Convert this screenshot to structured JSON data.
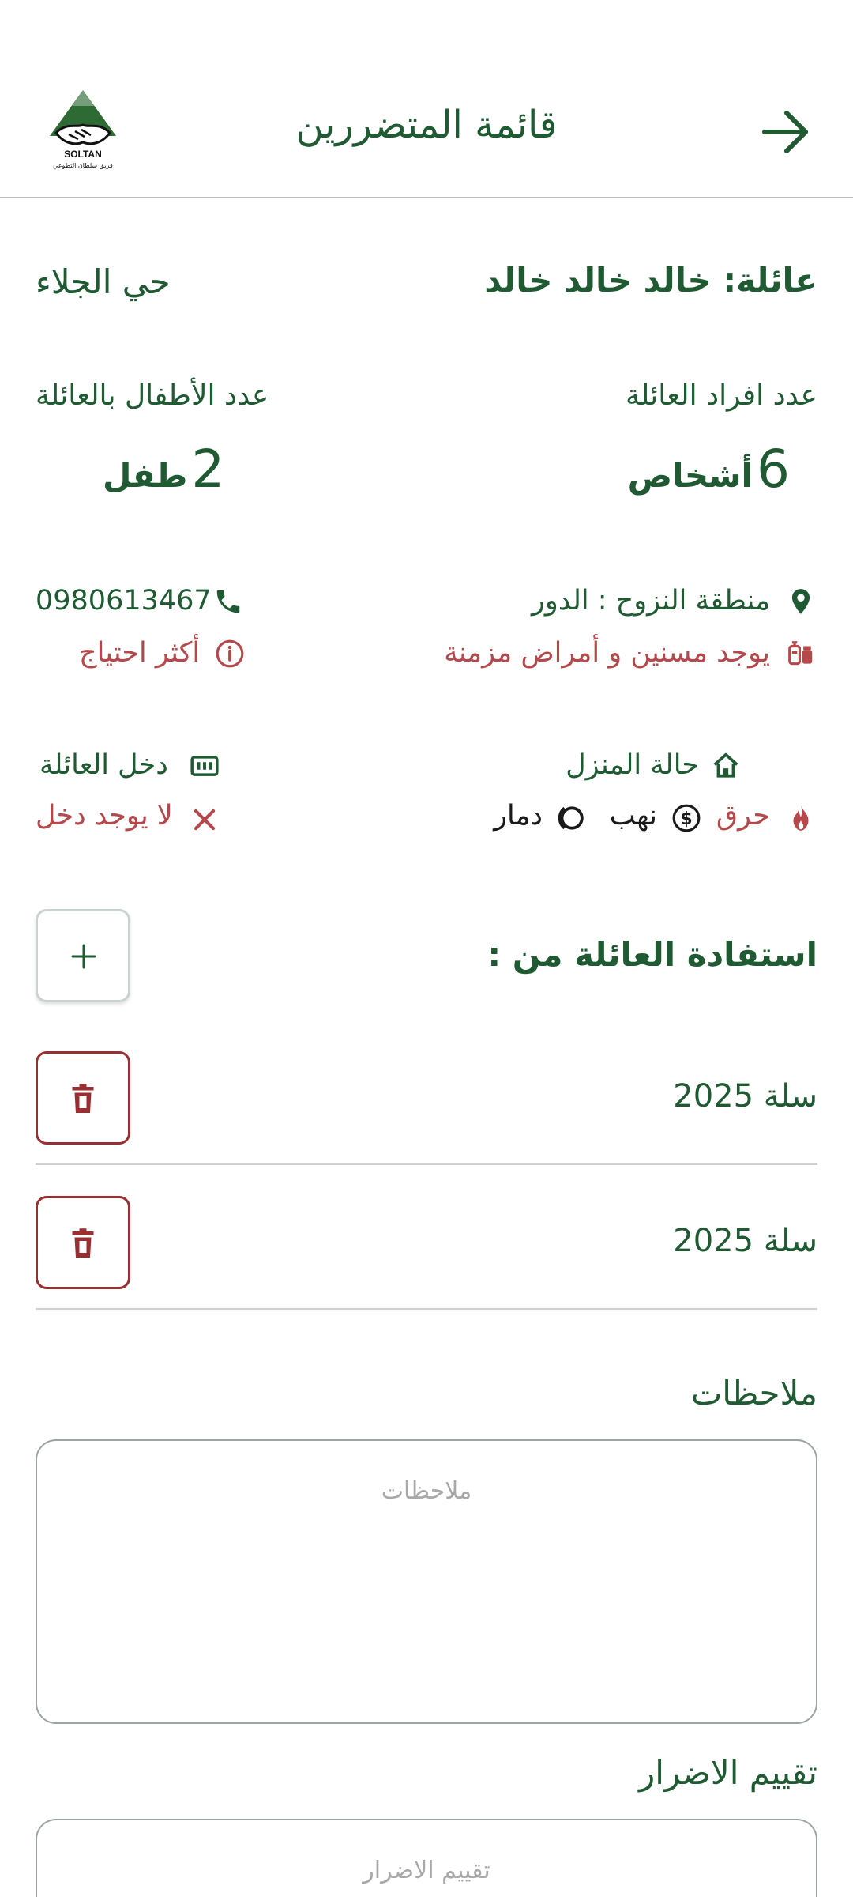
{
  "header": {
    "title": "قائمة المتضررين",
    "logo_text": "SOLTAN TEAM",
    "logo_subtext": "فريق سلطان التطوعي"
  },
  "family": {
    "name": "عائلة: خالد خالد خالد",
    "neighborhood": "حي الجلاء",
    "members_label": "عدد افراد  العائلة",
    "members_count": "6",
    "members_unit": "أشخاص",
    "children_label": "عدد الأطفال بالعائلة",
    "children_count": "2",
    "children_unit": "طفل",
    "displacement_area": "منطقة النزوح : الدور",
    "phone": "0980613467",
    "health_note": "يوجد مسنين و أمراض مزمنة",
    "need_level": "أكثر احتياج",
    "house_status_label": "حالة المنزل",
    "house_status": {
      "fire": "حرق",
      "looting": "نهب",
      "destruction": "دمار"
    },
    "income_label": "دخل العائلة",
    "income_value": "لا يوجد دخل"
  },
  "benefits": {
    "title": "استفادة العائلة من :",
    "items": [
      {
        "label": "سلة 2025"
      },
      {
        "label": "سلة 2025"
      }
    ]
  },
  "notes": {
    "label": "ملاحظات",
    "placeholder": "ملاحظات"
  },
  "damage": {
    "label": "تقييم الاضرار",
    "placeholder": "تقييم الاضرار"
  },
  "colors": {
    "primary": "#1f5a32",
    "warning": "#b5484a",
    "delete": "#9a2f31"
  }
}
